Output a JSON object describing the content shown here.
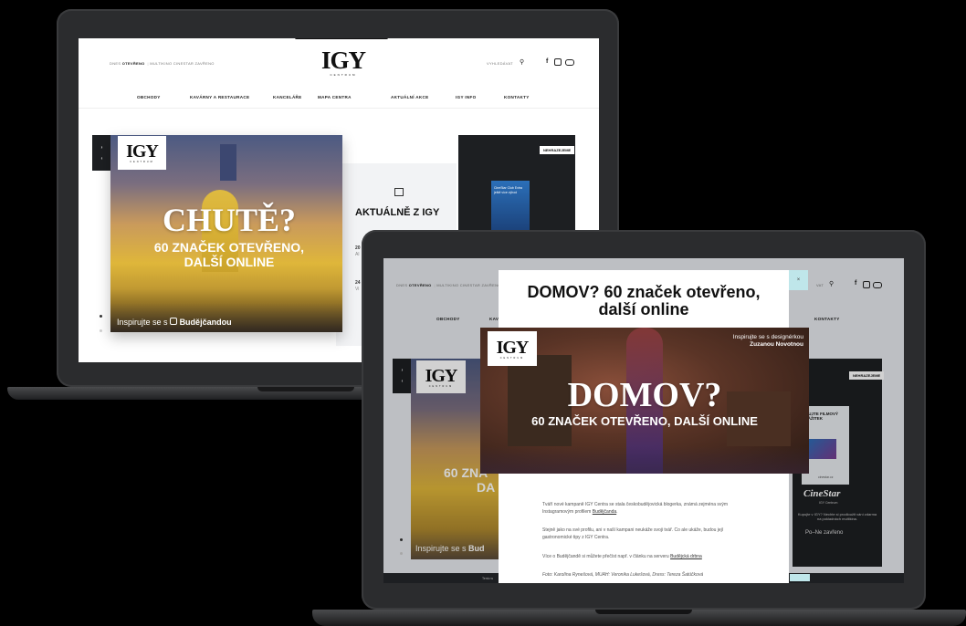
{
  "site": {
    "brand": "IGY",
    "brand_sub": "CENTRUM",
    "status_prefix": "DNES",
    "status": "OTEVŘENO",
    "status_extra": "MULTIKINO CINESTAR ZAVŘENO",
    "search_label": "VYHLEDÁVAT",
    "nav": [
      "OBCHODY",
      "KAVÁRNY A RESTAURACE",
      "KANCELÁŘE",
      "MAPA CENTRA",
      "AKTUÁLNÍ AKCE",
      "IGY INFO",
      "KONTAKTY"
    ]
  },
  "screen1": {
    "hero_big": "CHUTĚ?",
    "hero_line1": "60 ZNAČEK OTEVŘENO,",
    "hero_line2": "DALŠÍ ONLINE",
    "hero_caption_prefix": "Inspirujte se s",
    "hero_caption_handle": "Budějčandou",
    "news_title": "AKTUÁLNĚ Z IGY",
    "news_items": [
      "20",
      "Al",
      "24",
      "Vi"
    ],
    "promo_badge": "NEHRAZEJEME",
    "promo_card_line1": "CineStar Club Extra",
    "promo_card_line2": "ještě více výhod"
  },
  "screen2": {
    "status_prefix": "DNES",
    "status": "OTEVŘENO",
    "status_extra": "MULTIKINO CINESTAR ZAVŘENO",
    "search_short": "VAT",
    "nav_visible": [
      "OBCHODY",
      "KAV",
      "KONTAKTY"
    ],
    "bg_hero_line1": "60 ZNA",
    "bg_hero_line2": "DA",
    "bg_caption": "Inspirujte se s",
    "bg_caption_handle": "Bud",
    "promo_badge": "NEHRAZEJEME",
    "promo_card": "RUJTE FILMOVÝ ZÁŽITEK",
    "promo_card_small": "cinestar.cz",
    "cinestar_logo": "CineStar",
    "cinestar_sub": "IGY Centrum",
    "promo_text": "Kupujte v IGY? Nechte si prodloužit vání zdarma na pokladnách multikina.",
    "promo_hours": "Po–Ne zavřeno",
    "footer_text": "Tento w",
    "popup": {
      "title": "DOMOV? 60 značek otevřeno, další online",
      "close_icon": "×",
      "hero_caption_line1": "Inspirujte se s designérkou",
      "hero_caption_line2": "Zuzanou Novotnou",
      "hero_big": "DOMOV?",
      "hero_sub": "60 ZNAČEK OTEVŘENO, DALŠÍ ONLINE",
      "para1": "Tváří nové kampaně IGY Centra se stala českobudějovická blogerka, známá zejména svým Instagramovým profilem",
      "para1_link": "Budějčanda",
      "para2": "Stejně jako na své profilu, ani v naší kampani neukáže svoji tvář. Co ale ukáže, budou její gastronomické tipy z IGY Centra.",
      "para3": "Více o Budějčandě si můžete přečíst např. v článku na serveru",
      "para3_link": "Budějcká drbna",
      "para4": "Foto: Karolína Rynešová, MUAH: Veronika Lukešová, Dress: Tereza Šatúčková"
    }
  },
  "colors": {
    "accent": "#bfe6ea",
    "dark": "#1d1f22",
    "gold": "#dfb63a"
  }
}
